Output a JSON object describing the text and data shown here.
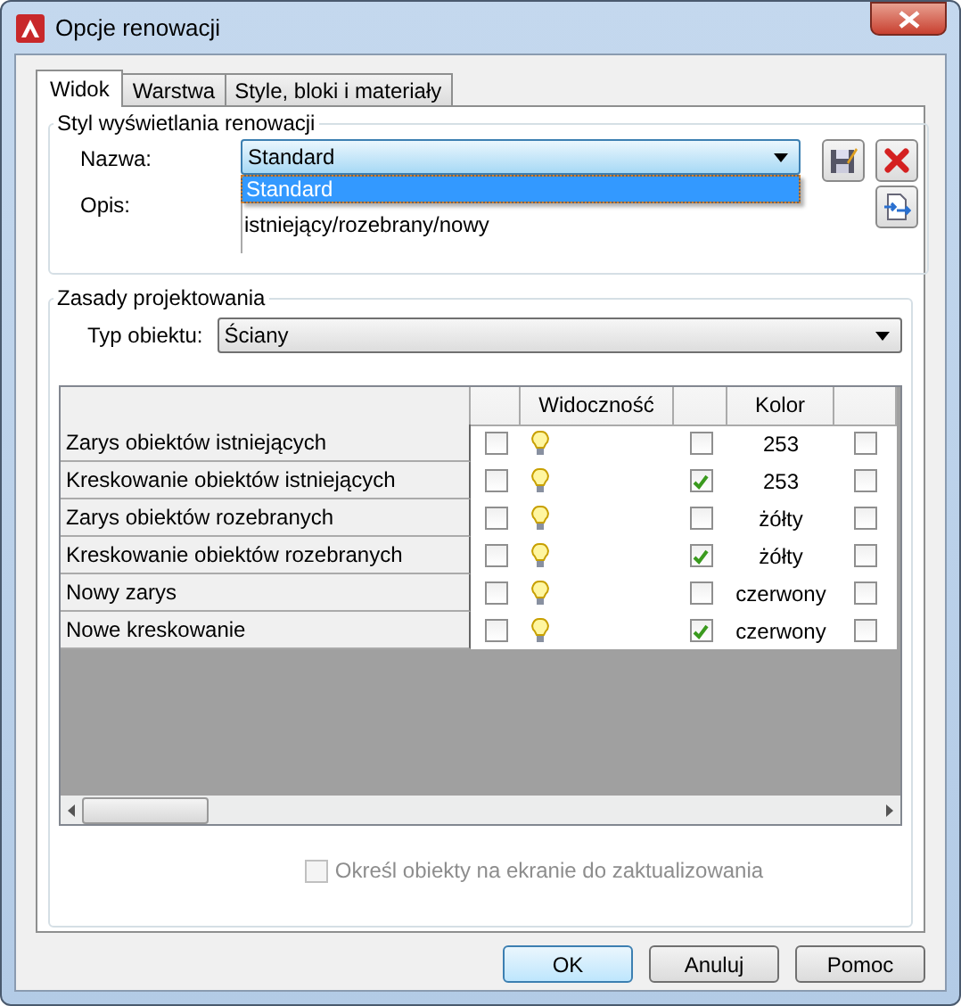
{
  "window": {
    "title": "Opcje renowacji"
  },
  "tabs": [
    {
      "label": "Widok",
      "selected": true
    },
    {
      "label": "Warstwa",
      "selected": false
    },
    {
      "label": "Style, bloki i materiały",
      "selected": false
    }
  ],
  "style_group": {
    "title": "Styl wyświetlania renowacji",
    "name_label": "Nazwa:",
    "name_value": "Standard",
    "dropdown_open": true,
    "dropdown_options": [
      {
        "label": "Standard",
        "selected": true
      }
    ],
    "description_label": "Opis:",
    "description_text": "istniejący/rozebrany/nowy"
  },
  "design_group": {
    "title": "Zasady projektowania",
    "object_type_label": "Typ obiektu:",
    "object_type_value": "Ściany",
    "table": {
      "visibility_header": "Widoczność",
      "color_header": "Kolor",
      "rows": [
        {
          "name": "Zarys obiektów istniejących",
          "column_2_checked": false,
          "column_4_checked": false,
          "color_name": "253",
          "column_6_checked": false
        },
        {
          "name": "Kreskowanie obiektów istniejących",
          "column_2_checked": false,
          "column_4_checked": true,
          "color_name": "253",
          "column_6_checked": false
        },
        {
          "name": "Zarys obiektów rozebranych",
          "column_2_checked": false,
          "column_4_checked": false,
          "color_name": "żółty",
          "column_6_checked": false
        },
        {
          "name": "Kreskowanie obiektów rozebranych",
          "column_2_checked": false,
          "column_4_checked": true,
          "color_name": "żółty",
          "column_6_checked": false
        },
        {
          "name": "Nowy zarys",
          "column_2_checked": false,
          "column_4_checked": false,
          "color_name": "czerwony",
          "column_6_checked": false
        },
        {
          "name": "Nowe kreskowanie",
          "column_2_checked": false,
          "column_4_checked": true,
          "color_name": "czerwony",
          "column_6_checked": false
        }
      ]
    }
  },
  "update_checkbox": {
    "label": "Określ obiekty na ekranie do zaktualizowania",
    "checked": false,
    "disabled": true
  },
  "buttons": [
    {
      "label": "OK",
      "default": true
    },
    {
      "label": "Anuluj",
      "default": false
    },
    {
      "label": "Pomoc",
      "default": false
    }
  ]
}
